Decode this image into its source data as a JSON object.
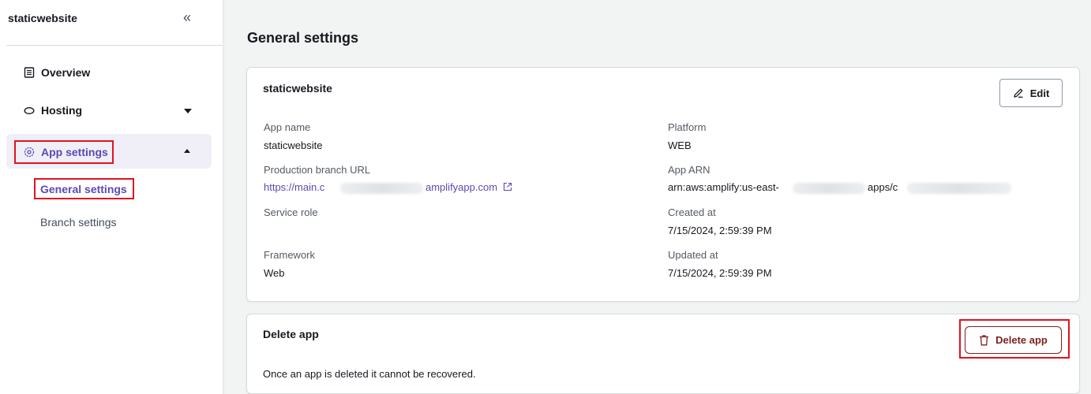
{
  "sidebar": {
    "app_title": "staticwebsite",
    "collapse_glyph": "«",
    "items": [
      {
        "label": "Overview",
        "icon": "document-icon"
      },
      {
        "label": "Hosting",
        "icon": "cloud-icon"
      },
      {
        "label": "App settings",
        "icon": "gear-icon"
      }
    ],
    "subitems": [
      {
        "label": "General settings",
        "active": true
      },
      {
        "label": "Branch settings",
        "active": false
      }
    ]
  },
  "page": {
    "title": "General settings"
  },
  "app_card": {
    "title": "staticwebsite",
    "edit_label": "Edit",
    "fields": {
      "app_name_label": "App name",
      "app_name_value": "staticwebsite",
      "prod_url_label": "Production branch URL",
      "prod_url_prefix": "https://main.c",
      "prod_url_suffix": "amplifyapp.com",
      "service_role_label": "Service role",
      "framework_label": "Framework",
      "framework_value": "Web",
      "platform_label": "Platform",
      "platform_value": "WEB",
      "arn_label": "App ARN",
      "arn_prefix": "arn:aws:amplify:us-east-",
      "arn_mid": "apps/c",
      "created_label": "Created at",
      "created_value": "7/15/2024, 2:59:39 PM",
      "updated_label": "Updated at",
      "updated_value": "7/15/2024, 2:59:39 PM"
    }
  },
  "delete_card": {
    "title": "Delete app",
    "button_label": "Delete app",
    "description": "Once an app is deleted it cannot be recovered."
  },
  "colors": {
    "accent": "#5a4ab4",
    "highlight_box": "#e3111e",
    "danger": "#7d1f1f"
  }
}
